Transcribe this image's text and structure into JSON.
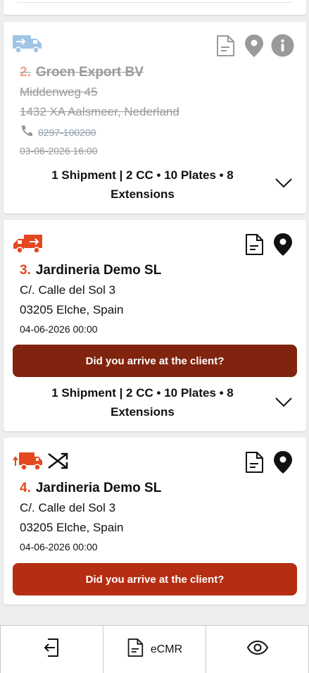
{
  "stops": [
    {
      "number": "2.",
      "name": "Groen Export BV",
      "street": "Middenweg 45",
      "city": "1432 XA Aalsmeer, Nederland",
      "phone": "0297-100200",
      "datetime": "03-06-2026 16:00",
      "summary": "1 Shipment | 2 CC • 10 Plates • 8 Extensions",
      "status": "completed"
    },
    {
      "number": "3.",
      "name": "Jardineria Demo SL",
      "street": "C/. Calle del Sol 3",
      "city": "03205 Elche, Spain",
      "datetime": "04-06-2026 00:00",
      "arrive_label": "Did you arrive at the client?",
      "summary": "1 Shipment | 2 CC • 10 Plates • 8 Extensions",
      "status": "active"
    },
    {
      "number": "4.",
      "name": "Jardineria Demo SL",
      "street": "C/. Calle del Sol 3",
      "city": "03205 Elche, Spain",
      "datetime": "04-06-2026 00:00",
      "arrive_label": "Did you arrive at the client?",
      "status": "pending"
    }
  ],
  "bottom_nav": {
    "ecmr_label": "eCMR"
  },
  "colors": {
    "accent_red": "#e5471f",
    "arrive_dark": "#80240f",
    "arrive_bright": "#b52d12",
    "done_truck_blue": "#9ec4e6"
  },
  "icons": [
    "truck-arrow-icon",
    "document-icon",
    "location-pin-icon",
    "info-icon",
    "phone-icon",
    "chevron-down-icon",
    "logout-icon",
    "eye-icon",
    "crossed-arrows-icon"
  ]
}
